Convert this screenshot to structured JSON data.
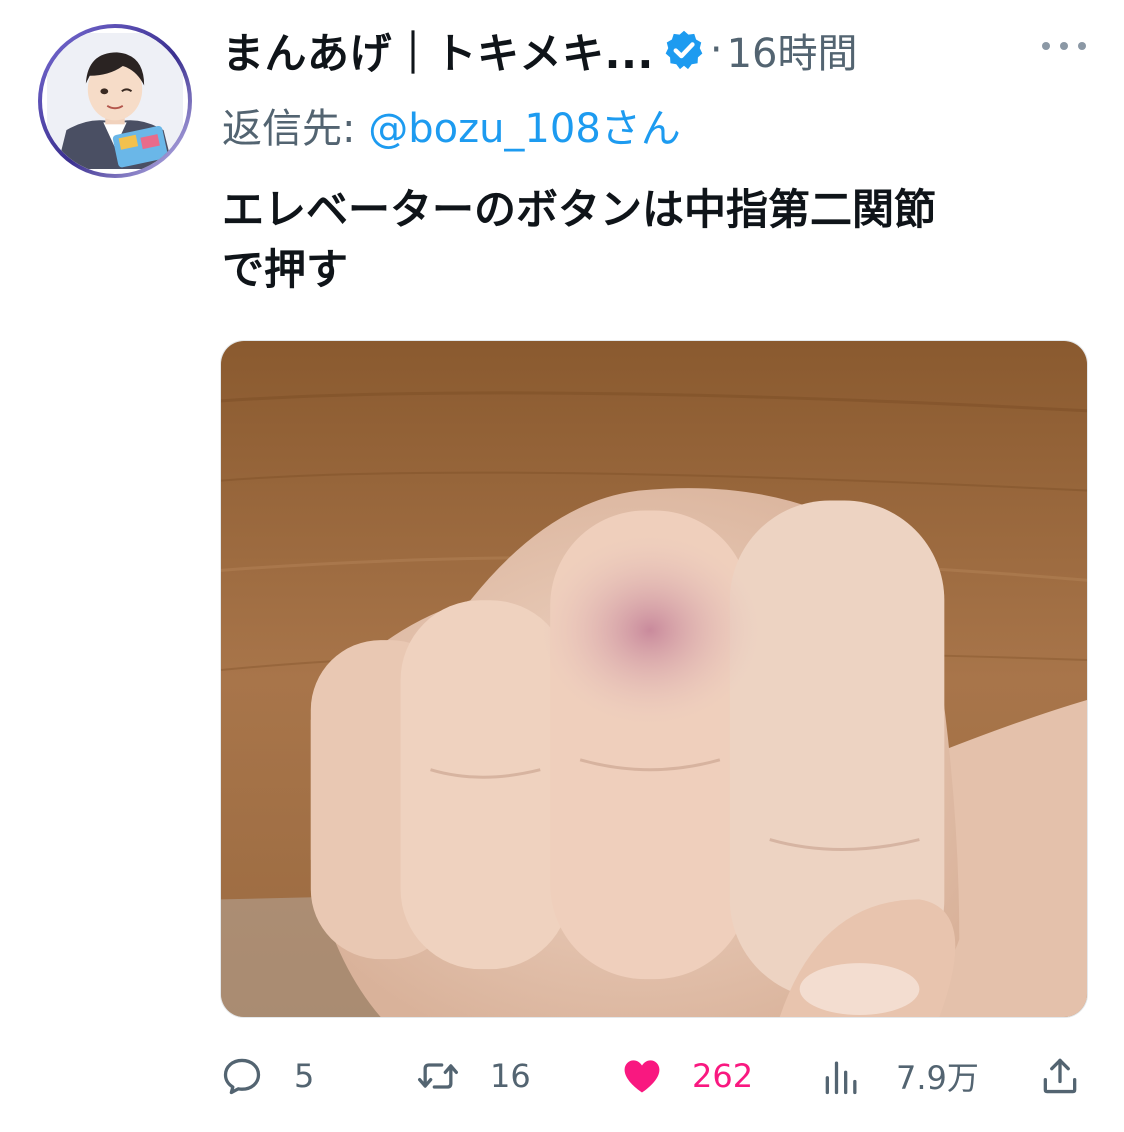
{
  "header": {
    "display_name": "まんあげ｜トキメキ...",
    "separator": "·",
    "time": "16時間"
  },
  "reply": {
    "prefix": "返信先:",
    "handle": "@bozu_108さん"
  },
  "tweet": {
    "text_line1": "エレベーターのボタンは中指第二関節",
    "text_line2": "で押す"
  },
  "actions": {
    "replies": "5",
    "retweets": "16",
    "likes": "262",
    "views": "7.9万"
  },
  "colors": {
    "text": "#0f1419",
    "muted": "#536471",
    "link": "#1d9bf0",
    "like": "#f91880",
    "verified": "#1d9bf0"
  },
  "icons": {
    "avatar": "avatar",
    "verified": "verified-badge-icon",
    "more": "more-options-icon",
    "reply": "reply-icon",
    "retweet": "retweet-icon",
    "like": "heart-icon",
    "views": "views-icon",
    "share": "share-icon"
  }
}
